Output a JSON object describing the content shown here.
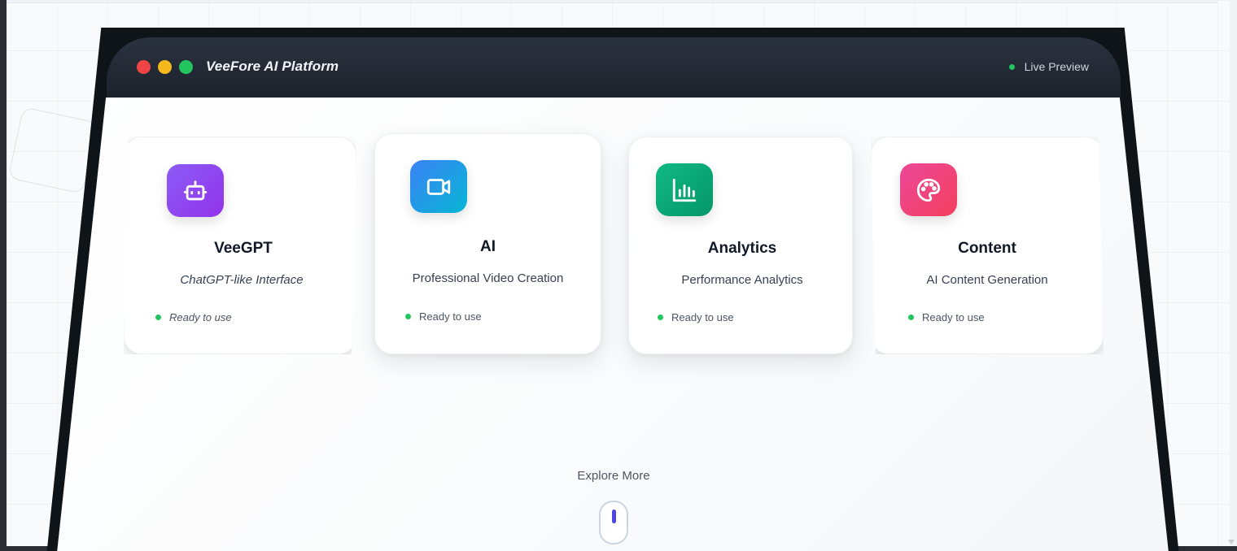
{
  "window": {
    "title": "VeeFore AI Platform",
    "live_label": "Live Preview"
  },
  "cards": [
    {
      "title": "VeeGPT",
      "subtitle": "ChatGPT-like Interface",
      "status": "Ready to use",
      "icon": "robot-icon",
      "color": "#8b5cf6"
    },
    {
      "title": "AI",
      "subtitle": "Professional Video Creation",
      "status": "Ready to use",
      "icon": "video-camera-icon",
      "color": "#3b82f6"
    },
    {
      "title": "Analytics",
      "subtitle": "Performance Analytics",
      "status": "Ready to use",
      "icon": "bar-chart-icon",
      "color": "#10b981"
    },
    {
      "title": "Content",
      "subtitle": "AI Content Generation",
      "status": "Ready to use",
      "icon": "palette-icon",
      "color": "#ec4899"
    }
  ],
  "explore": {
    "label": "Explore More"
  },
  "colors": {
    "status_green": "#22c55e",
    "scroll_indicator": "#4f46e5",
    "titlebar": "#1d222b"
  }
}
